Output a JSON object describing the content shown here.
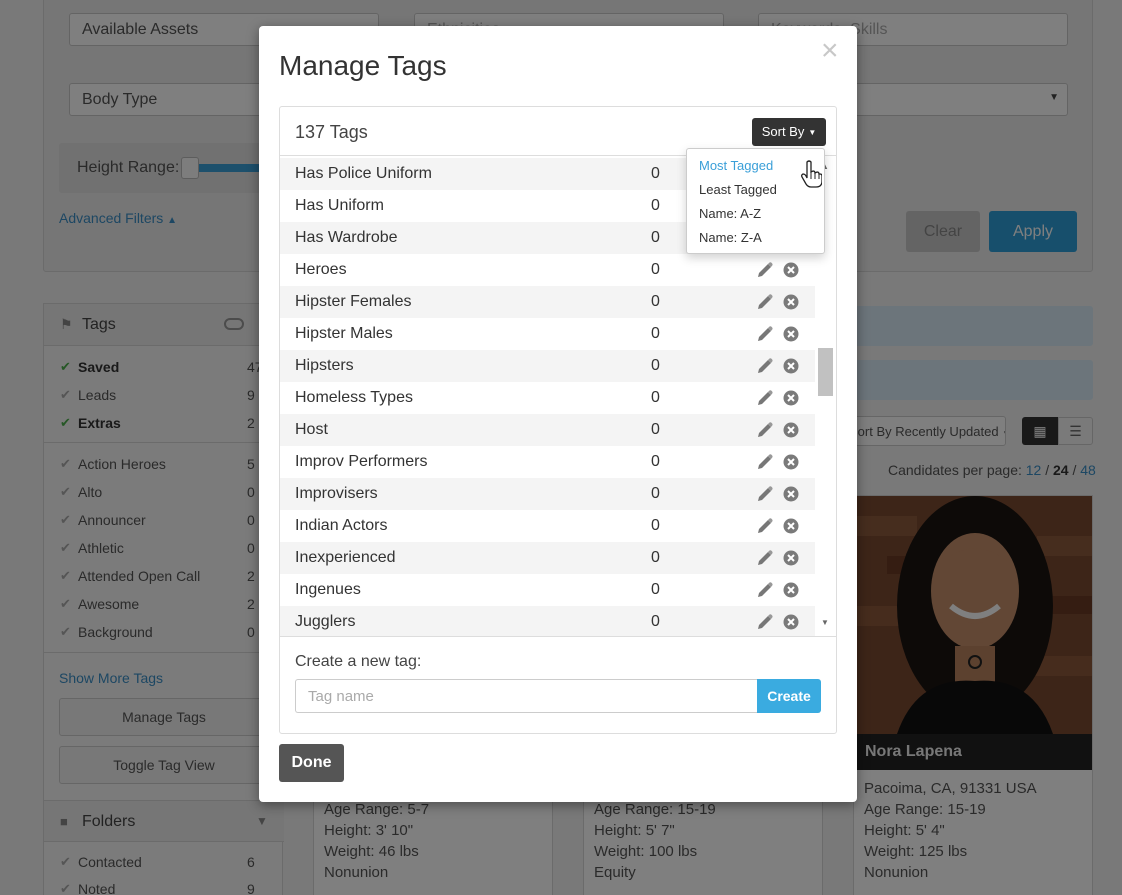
{
  "background": {
    "filters": {
      "available_assets": "Available Assets",
      "ethnicities_placeholder": "Ethnicities",
      "keywords_placeholder": "Keywords, Skills",
      "body_type": "Body Type",
      "height_range_label": "Height Range:",
      "advanced_filters": "Advanced Filters",
      "clear_label": "Clear",
      "apply_label": "Apply"
    },
    "sidebar": {
      "tags_title": "Tags",
      "saved_items": [
        {
          "label": "Saved",
          "count": "47"
        },
        {
          "label": "Leads",
          "count": "9"
        },
        {
          "label": "Extras",
          "count": "2"
        }
      ],
      "tag_items": [
        {
          "label": "Action Heroes",
          "count": "5"
        },
        {
          "label": "Alto",
          "count": "0"
        },
        {
          "label": "Announcer",
          "count": "0"
        },
        {
          "label": "Athletic",
          "count": "0"
        },
        {
          "label": "Attended Open Call",
          "count": "2"
        },
        {
          "label": "Awesome",
          "count": "2"
        },
        {
          "label": "Background",
          "count": "0"
        }
      ],
      "show_more": "Show More Tags",
      "manage_tags": "Manage Tags",
      "toggle_view": "Toggle Tag View",
      "folders_title": "Folders",
      "folder_items": [
        {
          "label": "Contacted",
          "count": "6"
        },
        {
          "label": "Noted",
          "count": "9"
        }
      ]
    },
    "results": {
      "sort_label": "Sort By Recently Updated",
      "per_page_label": "Candidates per page:",
      "per_page_options": [
        "12",
        "24",
        "48"
      ],
      "per_page_current": "24",
      "cards": [
        {
          "lines": [
            "Age Range: 5-7",
            "Height: 3' 10\"",
            "Weight: 46 lbs",
            "Nonunion"
          ]
        },
        {
          "lines": [
            "Age Range: 15-19",
            "Height: 5' 7\"",
            "Weight: 100 lbs",
            "Equity"
          ]
        },
        {
          "name": "Nora Lapena",
          "lines": [
            "Pacoima, CA, 91331 USA",
            "Age Range: 15-19",
            "Height: 5' 4\"",
            "Weight: 125 lbs",
            "Nonunion"
          ]
        }
      ]
    }
  },
  "modal": {
    "title": "Manage Tags",
    "tags_count": "137 Tags",
    "sort_button": "Sort By",
    "sort_options": [
      {
        "label": "Most Tagged",
        "active": true
      },
      {
        "label": "Least Tagged",
        "active": false
      },
      {
        "label": "Name: A-Z",
        "active": false
      },
      {
        "label": "Name: Z-A",
        "active": false
      }
    ],
    "tags": [
      {
        "name": "Has Police Uniform",
        "count": "0"
      },
      {
        "name": "Has Uniform",
        "count": "0"
      },
      {
        "name": "Has Wardrobe",
        "count": "0"
      },
      {
        "name": "Heroes",
        "count": "0"
      },
      {
        "name": "Hipster Females",
        "count": "0"
      },
      {
        "name": "Hipster Males",
        "count": "0"
      },
      {
        "name": "Hipsters",
        "count": "0"
      },
      {
        "name": "Homeless Types",
        "count": "0"
      },
      {
        "name": "Host",
        "count": "0"
      },
      {
        "name": "Improv Performers",
        "count": "0"
      },
      {
        "name": "Improvisers",
        "count": "0"
      },
      {
        "name": "Indian Actors",
        "count": "0"
      },
      {
        "name": "Inexperienced",
        "count": "0"
      },
      {
        "name": "Ingenues",
        "count": "0"
      },
      {
        "name": "Jugglers",
        "count": "0"
      }
    ],
    "create_label": "Create a new tag:",
    "create_placeholder": "Tag name",
    "create_button": "Create",
    "done_button": "Done"
  },
  "colors": {
    "accent": "#3aabe0",
    "apply": "#2e9fd8",
    "active_link": "#3a9fd8"
  }
}
